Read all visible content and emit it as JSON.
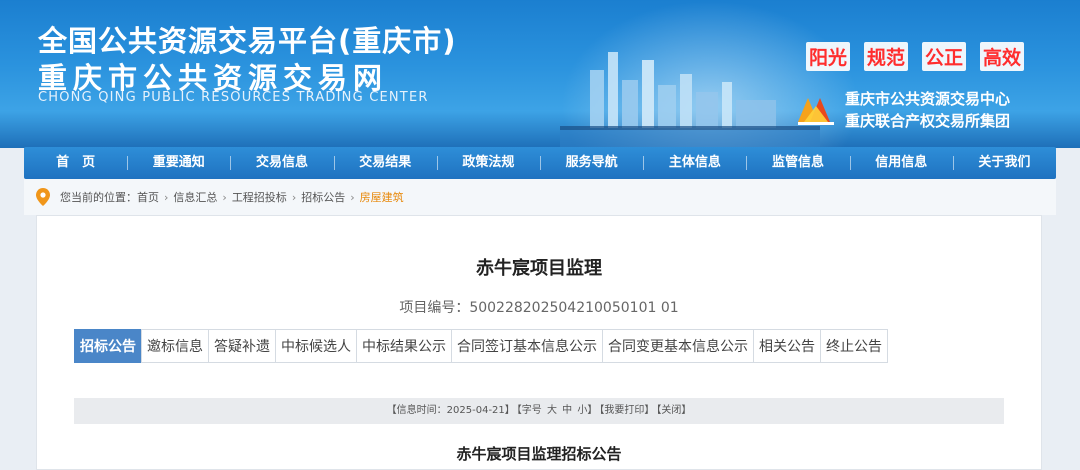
{
  "header": {
    "title_main": "全国公共资源交易平台(重庆市)",
    "title_sub": "重庆市公共资源交易网",
    "title_en": "CHONG QING PUBLIC RESOURCES TRADING CENTER",
    "slogans": [
      "阳光",
      "规范",
      "公正",
      "高效"
    ],
    "org_line1": "重庆市公共资源交易中心",
    "org_line2": "重庆联合产权交易所集团",
    "logo_icon": "cq-resources-logo-icon",
    "slogan_color": "#ff2d2d",
    "banner_color": "#2b93de"
  },
  "nav": {
    "items": [
      "首　页",
      "重要通知",
      "交易信息",
      "交易结果",
      "政策法规",
      "服务导航",
      "主体信息",
      "监管信息",
      "信用信息",
      "关于我们"
    ]
  },
  "breadcrumb": {
    "prefix": "您当前的位置：",
    "items": [
      "首页",
      "信息汇总",
      "工程招投标",
      "招标公告",
      "房屋建筑"
    ],
    "current_color": "#e8890b"
  },
  "project": {
    "title": "赤牛宸项目监理",
    "code_label": "项目编号：",
    "code": "500228202504210050101 01"
  },
  "tabs": {
    "items": [
      "招标公告",
      "邀标信息",
      "答疑补遗",
      "中标候选人",
      "中标结果公示",
      "合同签订基本信息公示",
      "合同变更基本信息公示",
      "相关公告",
      "终止公告"
    ],
    "active_index": 0,
    "active_color": "#4a86c8"
  },
  "infobar": {
    "time_text": "【信息时间：2025-04-21】",
    "font_open": "【字号",
    "font_large": "大",
    "font_medium": "中",
    "font_small": "小】",
    "print": "【我要打印】",
    "close": "【关闭】"
  },
  "document": {
    "title": "赤牛宸项目监理招标公告"
  }
}
